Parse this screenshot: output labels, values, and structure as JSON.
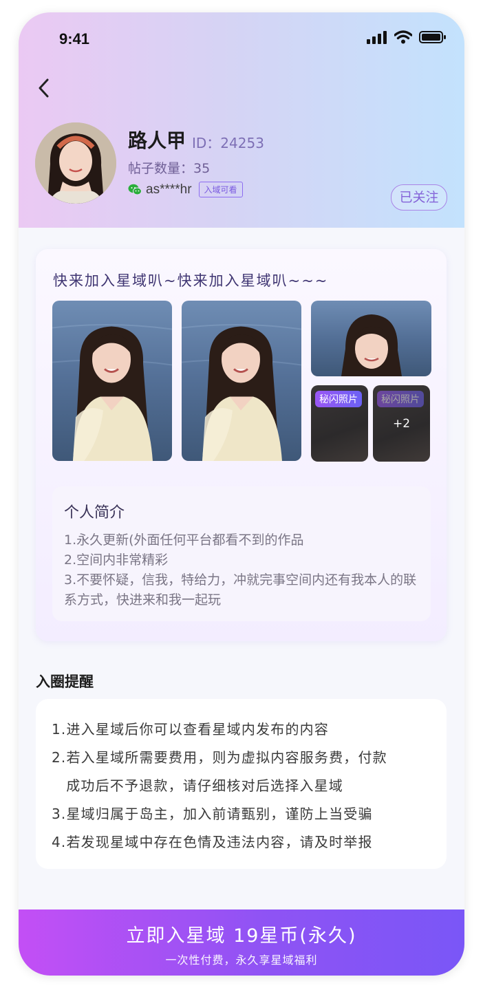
{
  "status_bar": {
    "time": "9:41"
  },
  "profile": {
    "name": "路人甲",
    "id_text": "ID：24253",
    "posts_text": "帖子数量：35",
    "wechat_id": "as****hr",
    "wechat_visibility": "入域可看",
    "follow_label": "已关注"
  },
  "domain_card": {
    "title": "快来加入星域叭~快来加入星域叭~~~",
    "flash_tag": "秘闪照片",
    "more_count": "+2",
    "bio": {
      "title": "个人简介",
      "lines": [
        "1.永久更新(外面任何平台都看不到的作品",
        "2.空间内非常精彩",
        "3.不要怀疑，信我，特给力，冲就完事空间内还有我本人的联系方式，快进来和我一起玩"
      ]
    }
  },
  "reminder": {
    "title": "入圈提醒",
    "lines": [
      "1.进入星域后你可以查看星域内发布的内容",
      "2.若入星域所需要费用，则为虚拟内容服务费，付款",
      "　成功后不予退款，请仔细核对后选择入星域",
      "3.星域归属于岛主，加入前请甄别，谨防上当受骗",
      "4.若发现星域中存在色情及违法内容，请及时举报"
    ]
  },
  "cta": {
    "main": "立即入星域 19星币(永久)",
    "sub": "一次性付费，永久享星域福利"
  },
  "colors": {
    "accent": "#8c5df2",
    "cta_start": "#c34ff5",
    "cta_end": "#7a56f7"
  }
}
